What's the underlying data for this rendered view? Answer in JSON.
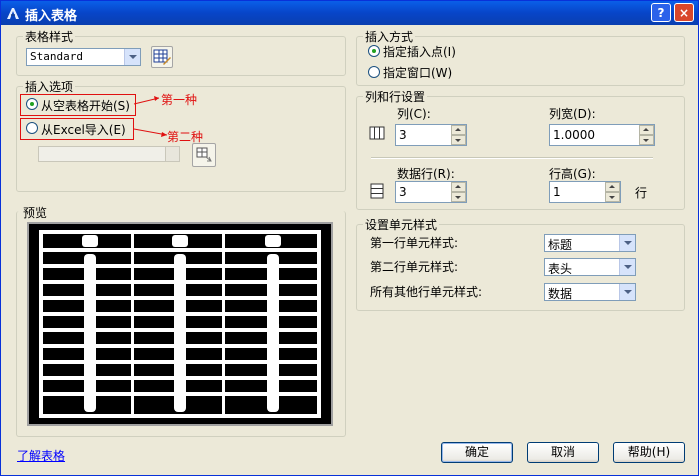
{
  "window": {
    "title": "插入表格",
    "help_button": "?",
    "close_button": "×"
  },
  "table_style": {
    "label": "表格样式",
    "value": "Standard"
  },
  "insert_options": {
    "label": "插入选项",
    "option_empty": "从空表格开始(S)",
    "option_excel": "从Excel导入(E)",
    "annotation_1": "第一种",
    "annotation_2": "第二种"
  },
  "preview": {
    "label": "预览"
  },
  "insert_method": {
    "label": "插入方式",
    "option_point": "指定插入点(I)",
    "option_window": "指定窗口(W)"
  },
  "rows_cols": {
    "label": "列和行设置",
    "cols_label": "列(C):",
    "cols_value": "3",
    "col_width_label": "列宽(D):",
    "col_width_value": "1.0000",
    "data_rows_label": "数据行(R):",
    "data_rows_value": "3",
    "row_height_label": "行高(G):",
    "row_height_value": "1",
    "row_unit": "行"
  },
  "cell_styles": {
    "label": "设置单元样式",
    "first_row_label": "第一行单元样式:",
    "first_row_value": "标题",
    "second_row_label": "第二行单元样式:",
    "second_row_value": "表头",
    "other_rows_label": "所有其他行单元样式:",
    "other_rows_value": "数据"
  },
  "footer": {
    "learn_link": "了解表格",
    "ok": "确定",
    "cancel": "取消",
    "help": "帮助(H)"
  },
  "colors": {
    "title_bar": "#0A5FE8",
    "dialog_bg": "#ECE9D8",
    "annotation_red": "#E01010",
    "link_blue": "#0000FF"
  }
}
